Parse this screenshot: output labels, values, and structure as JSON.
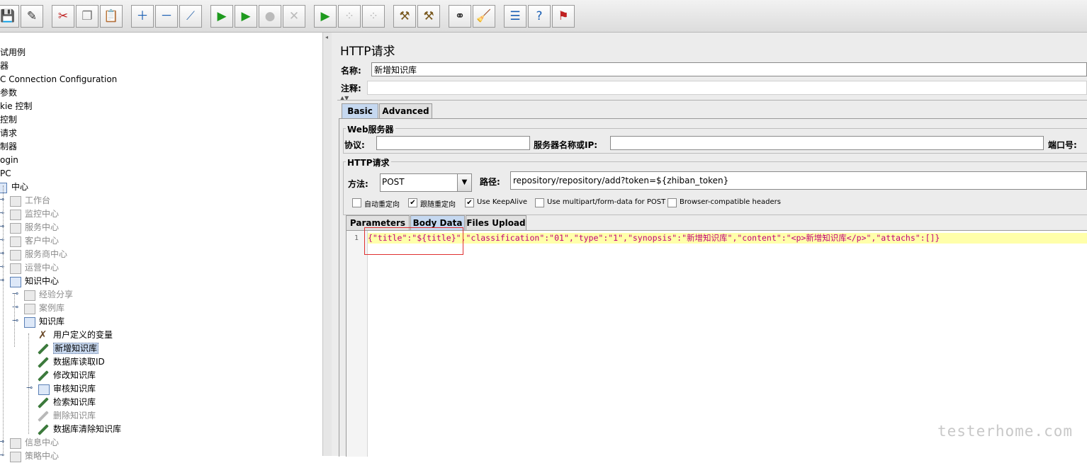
{
  "toolbar": {
    "buttons": [
      {
        "icon": "save-icon",
        "glyph": "💾"
      },
      {
        "icon": "save-as-icon",
        "glyph": "✎"
      },
      {
        "icon": "cut-icon",
        "glyph": "✂"
      },
      {
        "icon": "copy-icon",
        "glyph": "❐"
      },
      {
        "icon": "paste-icon",
        "glyph": "📋"
      },
      {
        "icon": "expand-icon",
        "glyph": "＋"
      },
      {
        "icon": "collapse-icon",
        "glyph": "－"
      },
      {
        "icon": "toggle-icon",
        "glyph": "⟋"
      },
      {
        "icon": "start-icon",
        "glyph": "▶"
      },
      {
        "icon": "start-no-pauses-icon",
        "glyph": "▶"
      },
      {
        "icon": "stop-icon",
        "glyph": "●"
      },
      {
        "icon": "shutdown-icon",
        "glyph": "✕"
      },
      {
        "icon": "remote-start-icon",
        "glyph": "▶"
      },
      {
        "icon": "remote-stop-icon",
        "glyph": "⁘"
      },
      {
        "icon": "remote-shutdown-icon",
        "glyph": "⁘"
      },
      {
        "icon": "clear-icon",
        "glyph": "⚒"
      },
      {
        "icon": "clear-all-icon",
        "glyph": "⚒"
      },
      {
        "icon": "search-icon",
        "glyph": "⚭"
      },
      {
        "icon": "reset-search-icon",
        "glyph": "🧹"
      },
      {
        "icon": "function-helper-icon",
        "glyph": "☰"
      },
      {
        "icon": "help-icon",
        "glyph": "?"
      },
      {
        "icon": "log-viewer-icon",
        "glyph": "⚑"
      }
    ]
  },
  "tree": {
    "items": [
      {
        "label": "试用例",
        "grey": false
      },
      {
        "label": "器",
        "grey": false
      },
      {
        "label": "C Connection Configuration",
        "grey": false
      },
      {
        "label": "参数",
        "grey": false
      },
      {
        "label": "kie 控制",
        "grey": false
      },
      {
        "label": "控制",
        "grey": false
      },
      {
        "label": "请求",
        "grey": false
      },
      {
        "label": "制器",
        "grey": false
      },
      {
        "label": "ogin",
        "grey": false
      },
      {
        "label": "PC",
        "grey": false
      },
      {
        "label": "中心",
        "grey": false
      },
      {
        "label": "工作台",
        "grey": true
      },
      {
        "label": "监控中心",
        "grey": true
      },
      {
        "label": "服务中心",
        "grey": true
      },
      {
        "label": "客户中心",
        "grey": true
      },
      {
        "label": "服务商中心",
        "grey": true
      },
      {
        "label": "运营中心",
        "grey": true
      },
      {
        "label": "知识中心",
        "grey": false
      },
      {
        "label": "经验分享",
        "grey": true
      },
      {
        "label": "案例库",
        "grey": true
      },
      {
        "label": "知识库",
        "grey": false
      },
      {
        "label": "用户定义的变量",
        "grey": false
      },
      {
        "label": "新增知识库",
        "grey": false
      },
      {
        "label": "数据库读取ID",
        "grey": false
      },
      {
        "label": "修改知识库",
        "grey": false
      },
      {
        "label": "审核知识库",
        "grey": false
      },
      {
        "label": "检索知识库",
        "grey": false
      },
      {
        "label": "删除知识库",
        "grey": true
      },
      {
        "label": "数据库清除知识库",
        "grey": false
      },
      {
        "label": "信息中心",
        "grey": true
      },
      {
        "label": "策略中心",
        "grey": true
      }
    ]
  },
  "panel": {
    "title": "HTTP请求",
    "name_label": "名称:",
    "name_value": "新增知识库",
    "comment_label": "注释:",
    "comment_value": "",
    "tabs": {
      "basic": "Basic",
      "advanced": "Advanced"
    },
    "web_server": {
      "legend": "Web服务器",
      "protocol_label": "协议:",
      "protocol_value": "",
      "server_label": "服务器名称或IP:",
      "server_value": "",
      "port_label": "端口号:"
    },
    "http_request": {
      "legend": "HTTP请求",
      "method_label": "方法:",
      "method_value": "POST",
      "path_label": "路径:",
      "path_value": "repository/repository/add?token=${zhiban_token}"
    },
    "options": [
      {
        "label": "自动重定向",
        "checked": false
      },
      {
        "label": "跟随重定向",
        "checked": true
      },
      {
        "label": "Use KeepAlive",
        "checked": true
      },
      {
        "label": "Use multipart/form-data for POST",
        "checked": false
      },
      {
        "label": "Browser-compatible headers",
        "checked": false
      }
    ],
    "body_tabs": {
      "parameters": "Parameters",
      "body_data": "Body Data",
      "files_upload": "Files Upload"
    },
    "editor": {
      "line_number": "1",
      "code": "{\"title\":\"${title}\",\"classification\":\"01\",\"type\":\"1\",\"synopsis\":\"新增知识库\",\"content\":\"<p>新增知识库</p>\",\"attachs\":[]}"
    }
  },
  "watermark": "testerhome.com",
  "colors": {
    "accent": "#c5d8f0",
    "highlight_line": "#ffffaa",
    "code_text": "#c0007a",
    "annotation_box": "#e03030"
  }
}
